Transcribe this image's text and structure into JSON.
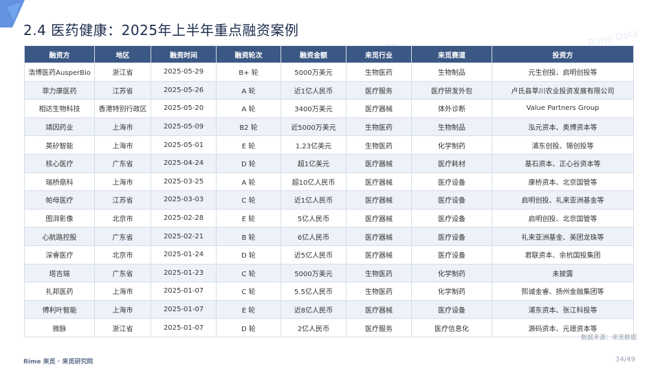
{
  "page": {
    "title": "2.4 医药健康：2025年上半年重点融资案例",
    "watermark_text": "Rime Data",
    "source": "数据来源：来觅数据",
    "footer": "Rime 来觅 · 来觅研究院",
    "page_number": "34/49",
    "colors": {
      "header_bg": "#3b5784",
      "row_alt_bg": "#edf1f8",
      "accent": "#2f6fd6"
    }
  },
  "table": {
    "headers": [
      "融资方",
      "地区",
      "融资时间",
      "融资轮次",
      "融资金额",
      "来觅行业",
      "来觅赛道",
      "投资方"
    ],
    "rows": [
      [
        "浩博医药AusperBio",
        "浙江省",
        "2025-05-29",
        "B+ 轮",
        "5000万美元",
        "生物医药",
        "生物制品",
        "元生创投、启明创投等"
      ],
      [
        "菲力康医药",
        "江苏省",
        "2025-05-26",
        "A 轮",
        "近1亿人民币",
        "医疗服务",
        "医疗研发外包",
        "卢氏县莘川农业投资发展有限公司"
      ],
      [
        "相达生物科技",
        "香港特别行政区",
        "2025-05-20",
        "A 轮",
        "3400万美元",
        "医疗器械",
        "体外诊断",
        "Value Partners Group"
      ],
      [
        "靖因药业",
        "上海市",
        "2025-05-09",
        "B2 轮",
        "近5000万美元",
        "生物医药",
        "生物制品",
        "泓元资本、奥博资本等"
      ],
      [
        "英矽智能",
        "上海市",
        "2025-05-01",
        "E 轮",
        "1.23亿美元",
        "生物医药",
        "化学制药",
        "浦东创投、锡创投等"
      ],
      [
        "核心医疗",
        "广东省",
        "2025-04-24",
        "D 轮",
        "超1亿美元",
        "医疗器械",
        "医疗耗材",
        "基石资本、正心谷资本等"
      ],
      [
        "瑞桥鼎科",
        "上海市",
        "2025-03-25",
        "A 轮",
        "超10亿人民币",
        "医疗器械",
        "医疗设备",
        "康桥资本、北京国管等"
      ],
      [
        "帕母医疗",
        "江苏省",
        "2025-03-03",
        "C 轮",
        "近1亿人民币",
        "医疗器械",
        "医疗设备",
        "启明创投、礼来亚洲基金等"
      ],
      [
        "图湃影像",
        "北京市",
        "2025-02-28",
        "E 轮",
        "5亿人民币",
        "医疗器械",
        "医疗设备",
        "启明创投、北京国管等"
      ],
      [
        "心航路控股",
        "广东省",
        "2025-02-21",
        "B 轮",
        "6亿人民币",
        "医疗器械",
        "医疗设备",
        "礼来亚洲基金、美团龙珠等"
      ],
      [
        "深睿医疗",
        "北京市",
        "2025-01-24",
        "D 轮",
        "近5亿人民币",
        "医疗器械",
        "医疗设备",
        "君联资本、余杭国投集团"
      ],
      [
        "塔吉瑞",
        "广东省",
        "2025-01-23",
        "C 轮",
        "5000万美元",
        "生物医药",
        "化学制药",
        "未披露"
      ],
      [
        "礼邦医药",
        "上海市",
        "2025-01-07",
        "C 轮",
        "5.5亿人民币",
        "生物医药",
        "化学制药",
        "熙诚金睿、扬州金融集团等"
      ],
      [
        "傅利叶智能",
        "上海市",
        "2025-01-07",
        "E 轮",
        "近8亿人民币",
        "医疗器械",
        "医疗设备",
        "浦东资本、张江科投等"
      ],
      [
        "微脉",
        "浙江省",
        "2025-01-07",
        "D 轮",
        "2亿人民币",
        "医疗服务",
        "医疗信息化",
        "源码资本、元璟资本等"
      ]
    ]
  }
}
